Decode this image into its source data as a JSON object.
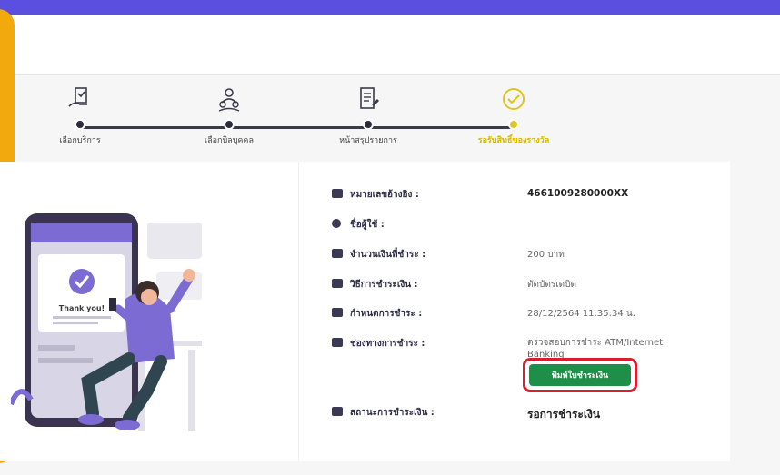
{
  "colors": {
    "topbar": "#5b4fe0",
    "accent_left": "#f2a90d",
    "active_step": "#e1c51e",
    "button_green": "#1f8e48",
    "highlight_red": "#d52030",
    "illustration_purple": "#7b6bd2"
  },
  "stepper": {
    "steps": [
      {
        "label": "เลือกบริการ",
        "icon": "service-doc-icon"
      },
      {
        "label": "เลือกบิลบุคคล",
        "icon": "person-group-icon"
      },
      {
        "label": "หน้าสรุปรายการ",
        "icon": "summary-doc-icon"
      },
      {
        "label": "รอรับสิทธิ์ของรางวัล",
        "icon": "check-circle-icon"
      }
    ],
    "active_index": 3
  },
  "illustration": {
    "text": "Thank you!"
  },
  "details": {
    "rows": [
      {
        "icon": "id-card-icon",
        "label": "หมายเลขอ้างอิง :",
        "value": "4661009280000XX"
      },
      {
        "icon": "user-icon",
        "label": "ชื่อผู้ใช้ :",
        "value": ""
      },
      {
        "icon": "money-icon",
        "label": "จำนวนเงินที่ชำระ :",
        "value": "200 บาท"
      },
      {
        "icon": "payment-method-icon",
        "label": "วิธีการชำระเงิน :",
        "value": "ตัดบัตรเดบิต"
      },
      {
        "icon": "calendar-icon",
        "label": "กำหนดการชำระ :",
        "value": "28/12/2564 11:35:34 น."
      },
      {
        "icon": "channel-icon",
        "label": "ช่องทางการชำระ :",
        "value": "ตรวจสอบการชำระ ATM/Internet Banking"
      },
      {
        "icon": "status-icon",
        "label": "สถานะการชำระเงิน :",
        "value": "รอการชำระเงิน"
      }
    ],
    "print_button_label": "พิมพ์ใบชำระเงิน"
  }
}
